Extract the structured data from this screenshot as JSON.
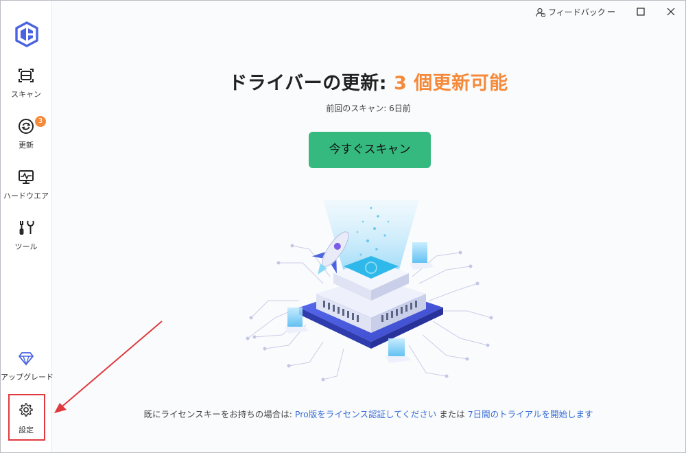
{
  "colors": {
    "accent_orange": "#f5893a",
    "scan_button": "#35b97f",
    "link": "#3a6fd8",
    "highlight_box": "#e0393e"
  },
  "sidebar": {
    "logo_icon": "driver-booster-logo-icon",
    "items": [
      {
        "label": "スキャン",
        "icon": "scan-icon"
      },
      {
        "label": "更新",
        "icon": "refresh-icon",
        "badge": "3"
      },
      {
        "label": "ハードウエア",
        "icon": "hardware-monitor-icon"
      },
      {
        "label": "ツール",
        "icon": "tools-icon"
      }
    ],
    "upgrade": {
      "label": "アップグレード",
      "icon": "diamond-icon"
    },
    "settings": {
      "label": "設定",
      "icon": "gear-icon"
    }
  },
  "titlebar": {
    "feedback_label": "フィードバック",
    "feedback_icon": "user-feedback-icon"
  },
  "main": {
    "title_prefix": "ドライバーの更新:",
    "title_highlight": "3 個更新可能",
    "last_scan": "前回のスキャン: 6日前",
    "scan_button": "今すぐスキャン"
  },
  "footer": {
    "text_before": "既にライセンスキーをお持ちの場合は:",
    "link_pro": "Pro版をライセンス認証してください",
    "text_or": "または",
    "link_trial": "7日間のトライアルを開始します"
  }
}
